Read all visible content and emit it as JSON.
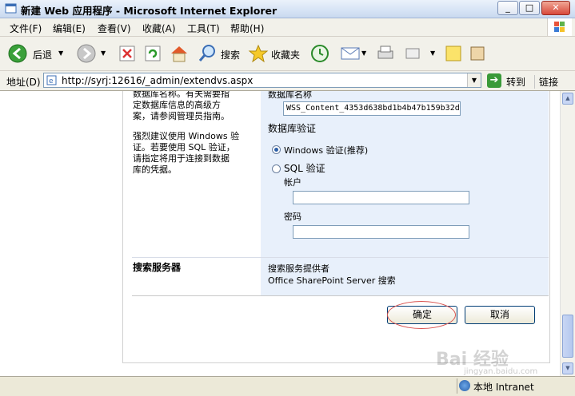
{
  "window": {
    "title": "新建 Web 应用程序 - Microsoft Internet Explorer",
    "minimize": "_",
    "maximize": "□",
    "close": "✕"
  },
  "menu": {
    "file": "文件(F)",
    "edit": "编辑(E)",
    "view": "查看(V)",
    "favorites": "收藏(A)",
    "tools": "工具(T)",
    "help": "帮助(H)"
  },
  "toolbar": {
    "back_label": "后退",
    "search_label": "搜索",
    "favorites_label": "收藏夹"
  },
  "address": {
    "label": "地址(D)",
    "url": "http://syrj:12616/_admin/extendvs.aspx",
    "go_label": "转到",
    "links_label": "链接"
  },
  "page": {
    "left_help_1": [
      "数据库名称。有关需要指",
      "定数据库信息的高级方",
      "案，请参阅管理员指南。"
    ],
    "left_help_2": [
      "强烈建议使用 Windows 验",
      "证。若要使用 SQL 验证，",
      "请指定将用于连接到数据",
      "库的凭据。"
    ],
    "db_name_label": "数据库名称",
    "db_name_value": "WSS_Content_4353d638bd1b4b47b159b32d",
    "db_auth_label": "数据库验证",
    "windows_auth_label": "Windows 验证(推荐)",
    "sql_auth_label": "SQL 验证",
    "account_label": "帐户",
    "password_label": "密码",
    "search_server_heading": "搜索服务器",
    "search_provider_label": "搜索服务提供者",
    "search_provider_value": "Office SharePoint Server 搜索",
    "ok_button": "确定",
    "cancel_button": "取消"
  },
  "status": {
    "zone": "本地 Intranet"
  },
  "watermark": {
    "text": "Bai 经验",
    "sub": "jingyan.baidu.com"
  }
}
